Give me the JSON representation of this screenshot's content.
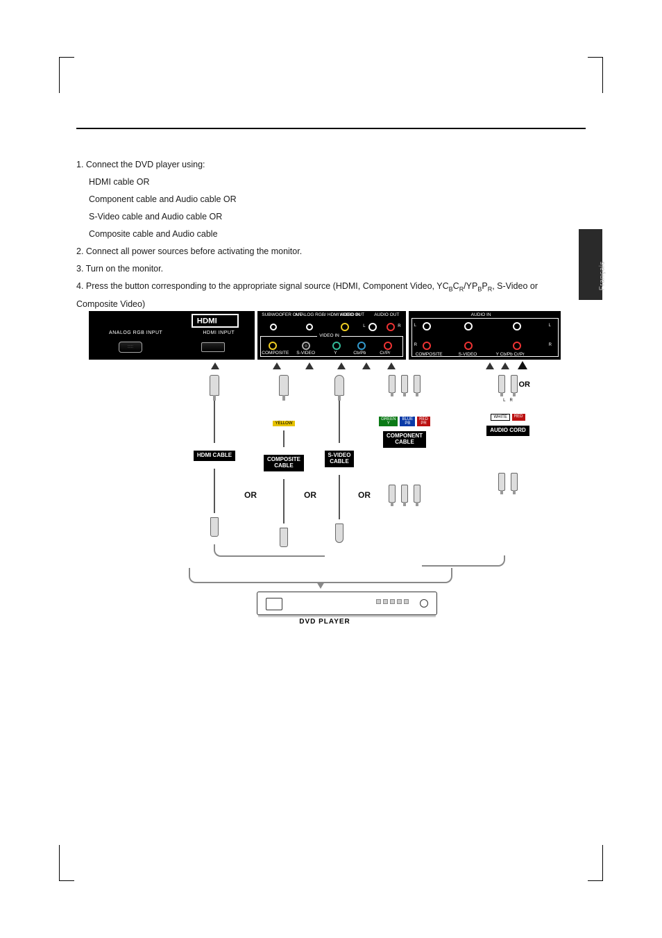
{
  "side_tab_label": "Français",
  "instructions": {
    "step1_lead": "1. Connect the DVD player using:",
    "step1_opts": [
      "HDMI cable OR",
      "Component cable and Audio cable OR",
      "S-Video cable and Audio cable OR",
      "Composite cable and Audio cable"
    ],
    "step2": "2. Connect all power sources before activating the monitor.",
    "step3": "3. Turn on the monitor.",
    "step4_pre": "4. Press the button corresponding to the appropriate signal source (HDMI, Component Video, YC",
    "step4_sub1": "B",
    "step4_mid1": "C",
    "step4_sub2": "R",
    "step4_mid2": "/YP",
    "step4_sub3": "B",
    "step4_mid3": "P",
    "step4_sub4": "R",
    "step4_post": ", S-Video or Composite Video)"
  },
  "panel_left": {
    "col1": "ANALOG RGB INPUT",
    "col2": "HDMI INPUT"
  },
  "panel_mid": {
    "sub_out": "SUBWOOFER\nOUT",
    "hdmi_audio": "ANALOG RGB/\nHDMI AUDIO IN",
    "video_out": "VIDEO\nOUT",
    "audio_out": "AUDIO\nOUT",
    "L": "L",
    "R": "R",
    "video_in": "VIDEO IN",
    "composite": "COMPOSITE",
    "svideo": "S-VIDEO",
    "y": "Y",
    "cbpb": "Cb/Pb",
    "crpr": "Cr/Pr"
  },
  "panel_right": {
    "audio_in": "AUDIO IN",
    "L": "L",
    "R": "R",
    "composite": "COMPOSITE",
    "svideo": "S-VIDEO",
    "ycbcr": "Y Cb/Pb Cr/Pr"
  },
  "or_label": "OR",
  "cable_labels": {
    "hdmi": "HDMI CABLE",
    "composite": "COMPOSITE\nCABLE",
    "svideo": "S-VIDEO\nCABLE",
    "component": "COMPONENT\nCABLE",
    "audio": "AUDIO CORD"
  },
  "color_tags": {
    "yellow": "YELLOW",
    "green": "GREEN\nY",
    "blue": "BLUE\nPB",
    "red": "RED\nPR",
    "white": "WHITE",
    "red2": "RED",
    "l": "L",
    "r": "R"
  },
  "dvd_label": "DVD PLAYER"
}
